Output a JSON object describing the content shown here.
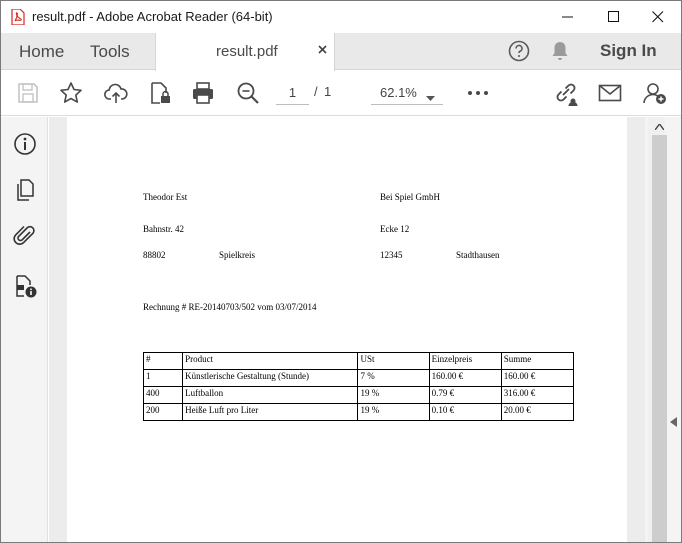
{
  "window": {
    "title": "result.pdf - Adobe Acrobat Reader (64-bit)"
  },
  "tabs": {
    "home": "Home",
    "tools": "Tools",
    "document": "result.pdf",
    "sign_in": "Sign In"
  },
  "toolbar": {
    "current_page": "1",
    "page_separator": "/",
    "total_pages": "1",
    "zoom": "62.1%",
    "icons": [
      "save-icon",
      "star-icon",
      "upload-cloud-icon",
      "protect-file-icon",
      "print-icon",
      "zoom-search-icon",
      "more-icon",
      "share-link-icon",
      "email-icon",
      "add-user-icon"
    ]
  },
  "left_rail": {
    "icons": [
      "info-icon",
      "pages-icon",
      "attachment-icon",
      "file-info-icon"
    ]
  },
  "document": {
    "seller": {
      "name": "Theodor Est",
      "street": "Bahnstr. 42",
      "zip": "88802",
      "city": "Spielkreis"
    },
    "buyer": {
      "name": "Bei Spiel GmbH",
      "street": "Ecke 12",
      "zip": "12345",
      "city": "Stadthausen"
    },
    "invoice_line": "Rechnung # RE-20140703/502 vom 03/07/2014",
    "table": {
      "headers": [
        "#",
        "Product",
        "USt",
        "Einzelpreis",
        "Summe"
      ],
      "rows": [
        [
          "1",
          "Künstlerische Gestaltung (Stunde)",
          "7 %",
          "160.00 €",
          "160.00 €"
        ],
        [
          "400",
          "Luftballon",
          "19 %",
          "0.79 €",
          "316.00 €"
        ],
        [
          "200",
          "Heiße Luft pro Liter",
          "19 %",
          "0.10 €",
          "20.00 €"
        ]
      ]
    }
  },
  "colors": {
    "accent_red": "#d9251c",
    "icon_gray": "#4a4a4a",
    "tabbar_bg": "#e9e9e9"
  }
}
